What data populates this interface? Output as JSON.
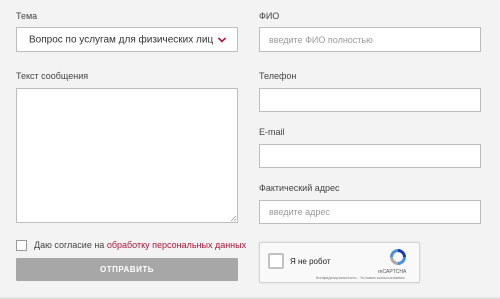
{
  "form": {
    "topic": {
      "label": "Тема",
      "value": "Вопрос по услугам для физических лиц"
    },
    "message": {
      "label": "Текст сообщения",
      "value": ""
    },
    "fio": {
      "label": "ФИО",
      "placeholder": "введите ФИО полностью"
    },
    "phone": {
      "label": "Телефон",
      "placeholder": ""
    },
    "email": {
      "label": "E-mail",
      "placeholder": ""
    },
    "address": {
      "label": "Фактический адрес",
      "placeholder": "введите адрес"
    },
    "consent": {
      "prefix": "Даю согласие на ",
      "link": "обработку персональных данных",
      "checked": false
    },
    "submit_label": "ОТПРАВИТЬ"
  },
  "recaptcha": {
    "label": "Я не робот",
    "brand": "reCAPTCHA",
    "terms": "Конфиденциальность - Условия использования"
  },
  "colors": {
    "accent": "#b0163c",
    "button": "#a7a7a7",
    "background": "#f3f3f3"
  },
  "icons": {
    "select_toggle": "chevron-down-icon",
    "recaptcha_logo": "recaptcha-logo-icon"
  }
}
